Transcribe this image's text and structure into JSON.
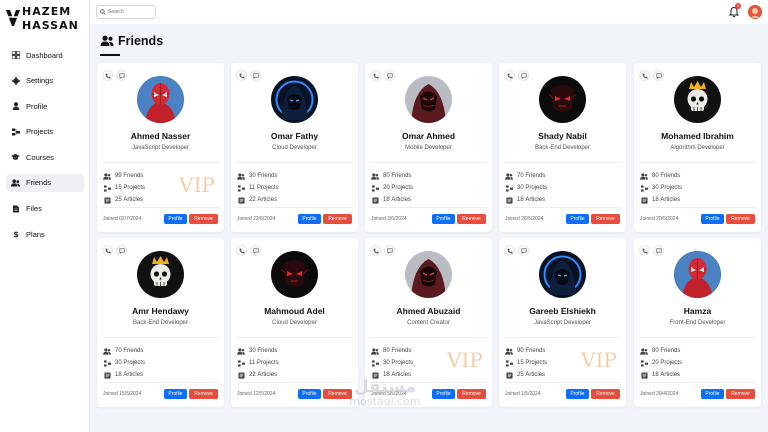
{
  "brand": {
    "line1": "HAZEM",
    "line2": "HASSAN"
  },
  "sidebar": {
    "items": [
      {
        "label": "Dashboard",
        "icon": "dashboard-icon",
        "active": false
      },
      {
        "label": "Settings",
        "icon": "gear-icon",
        "active": false
      },
      {
        "label": "Profile",
        "icon": "user-icon",
        "active": false
      },
      {
        "label": "Projects",
        "icon": "projects-icon",
        "active": false
      },
      {
        "label": "Courses",
        "icon": "graduation-cap-icon",
        "active": false
      },
      {
        "label": "Friends",
        "icon": "users-icon",
        "active": true
      },
      {
        "label": "Files",
        "icon": "files-icon",
        "active": false
      },
      {
        "label": "Plans",
        "icon": "dollar-icon",
        "active": false
      }
    ]
  },
  "header": {
    "search_placeholder": "Search",
    "notification_count": "1"
  },
  "page": {
    "title": "Friends"
  },
  "labels": {
    "profile_button": "Profile",
    "remove_button": "Remove",
    "friends_suffix": "Friends",
    "projects_suffix": "Projects",
    "articles_suffix": "Articles",
    "joined_prefix": "Joined",
    "vip": "VIP"
  },
  "friends": [
    {
      "name": "Ahmed Nasser",
      "role": "JavaScript Developer",
      "friends": "99",
      "projects": "15",
      "articles": "25",
      "joined": "02/7/2024",
      "vip": true,
      "avatar": "spiderman"
    },
    {
      "name": "Omar Fathy",
      "role": "Cloud Developer",
      "friends": "30",
      "projects": "11",
      "articles": "22",
      "joined": "22/6/2024",
      "vip": false,
      "avatar": "hooded-blue"
    },
    {
      "name": "Omar Ahmed",
      "role": "Mobile Developer",
      "friends": "80",
      "projects": "20",
      "articles": "18",
      "joined": "2/6/2024",
      "vip": false,
      "avatar": "hooded-red"
    },
    {
      "name": "Shady Nabil",
      "role": "Back-End Developer",
      "friends": "70",
      "projects": "30",
      "articles": "18",
      "joined": "28/5/2024",
      "vip": false,
      "avatar": "red-mask"
    },
    {
      "name": "Mohamed Ibrahim",
      "role": "Algorithm Developer",
      "friends": "80",
      "projects": "30",
      "articles": "18",
      "joined": "20/5/2024",
      "vip": false,
      "avatar": "skull-crown"
    },
    {
      "name": "Amr Hendawy",
      "role": "Back-End Developer",
      "friends": "70",
      "projects": "30",
      "articles": "18",
      "joined": "15/5/2024",
      "vip": false,
      "avatar": "skull-crown"
    },
    {
      "name": "Mahmoud Adel",
      "role": "Cloud Developer",
      "friends": "30",
      "projects": "11",
      "articles": "22",
      "joined": "12/5/2024",
      "vip": false,
      "avatar": "red-mask"
    },
    {
      "name": "Ahmed Abuzaid",
      "role": "Content Creator",
      "friends": "80",
      "projects": "30",
      "articles": "18",
      "joined": "5/5/2024",
      "vip": true,
      "avatar": "hooded-red"
    },
    {
      "name": "Gareeb Elshiekh",
      "role": "JavaScript Developer",
      "friends": "90",
      "projects": "15",
      "articles": "25",
      "joined": "1/5/2024",
      "vip": true,
      "avatar": "hooded-blue"
    },
    {
      "name": "Hamza",
      "role": "Front-End Developer",
      "friends": "80",
      "projects": "20",
      "articles": "18",
      "joined": "20/4/2024",
      "vip": false,
      "avatar": "spiderman"
    }
  ],
  "watermark": {
    "arabic": "مستقل",
    "latin": "mostaql.com"
  },
  "colors": {
    "primary": "#0d6efd",
    "danger": "#e74c3c",
    "vip": "#f6c89f",
    "background": "#f1f5f9"
  }
}
